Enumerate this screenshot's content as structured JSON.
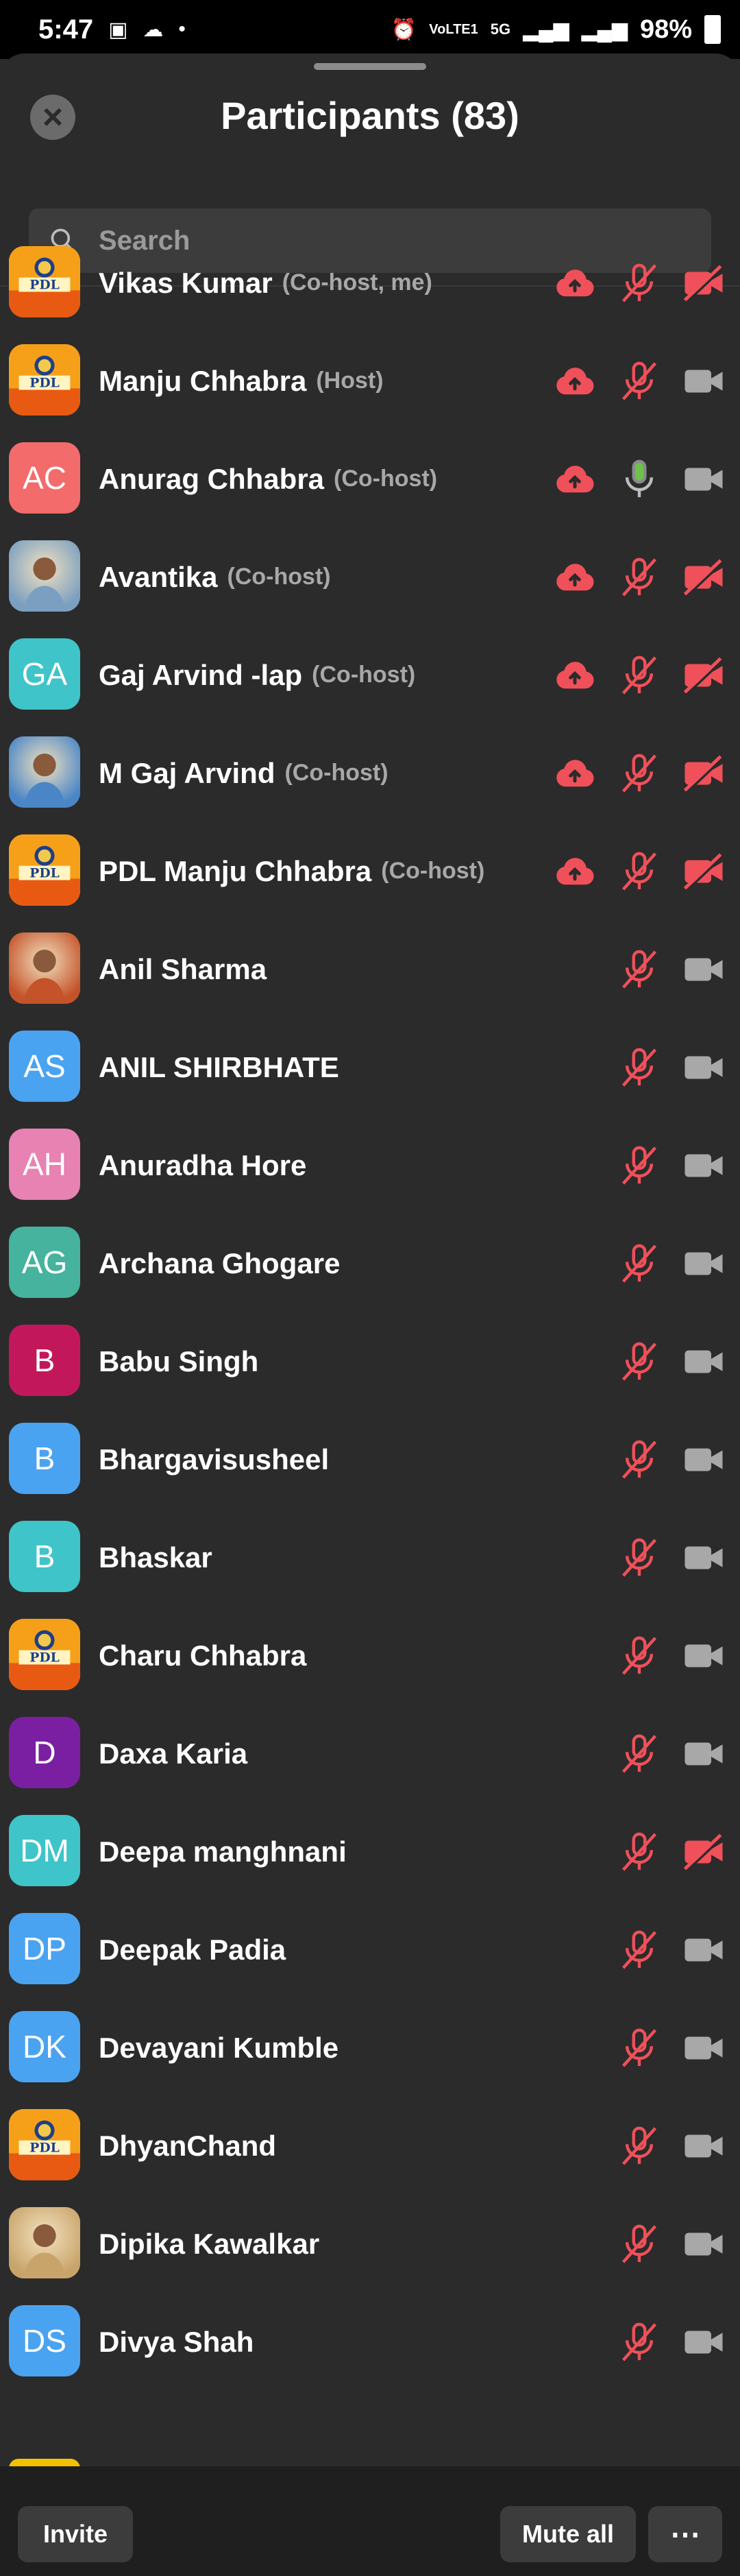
{
  "status": {
    "time": "5:47",
    "battery": "98%",
    "net1": "VoLTE1",
    "net2": "5G"
  },
  "header": {
    "title": "Participants (83)"
  },
  "search": {
    "placeholder": "Search"
  },
  "participants": [
    {
      "name": "Vikas Kumar",
      "role": "(Co-host, me)",
      "avatar_type": "logo",
      "initials": "",
      "color": "#e8a12c",
      "cloud": true,
      "mic": "muted",
      "video": "off"
    },
    {
      "name": "Manju Chhabra",
      "role": "(Host)",
      "avatar_type": "logo",
      "initials": "",
      "color": "#e8a12c",
      "cloud": true,
      "mic": "muted",
      "video": "on"
    },
    {
      "name": "Anurag Chhabra",
      "role": "(Co-host)",
      "avatar_type": "initials",
      "initials": "AC",
      "color": "#f36b6b",
      "cloud": true,
      "mic": "active",
      "video": "on"
    },
    {
      "name": "Avantika",
      "role": "(Co-host)",
      "avatar_type": "photo",
      "initials": "",
      "color": "#7a9fc0",
      "cloud": true,
      "mic": "muted",
      "video": "off"
    },
    {
      "name": "Gaj Arvind -lap",
      "role": "(Co-host)",
      "avatar_type": "initials",
      "initials": "GA",
      "color": "#3fc4c9",
      "cloud": true,
      "mic": "muted",
      "video": "off"
    },
    {
      "name": "M Gaj Arvind",
      "role": "(Co-host)",
      "avatar_type": "photo",
      "initials": "",
      "color": "#4a86c6",
      "cloud": true,
      "mic": "muted",
      "video": "off"
    },
    {
      "name": "PDL Manju Chhabra",
      "role": "(Co-host)",
      "avatar_type": "logo",
      "initials": "",
      "color": "#e8a12c",
      "cloud": true,
      "mic": "muted",
      "video": "off"
    },
    {
      "name": "Anil Sharma",
      "role": "",
      "avatar_type": "photo",
      "initials": "",
      "color": "#c4532a",
      "cloud": false,
      "mic": "muted",
      "video": "on"
    },
    {
      "name": "ANIL SHIRBHATE",
      "role": "",
      "avatar_type": "initials",
      "initials": "AS",
      "color": "#4aa3f0",
      "cloud": false,
      "mic": "muted",
      "video": "on"
    },
    {
      "name": "Anuradha Hore",
      "role": "",
      "avatar_type": "initials",
      "initials": "AH",
      "color": "#e782b2",
      "cloud": false,
      "mic": "muted",
      "video": "on"
    },
    {
      "name": "Archana Ghogare",
      "role": "",
      "avatar_type": "initials",
      "initials": "AG",
      "color": "#45b39d",
      "cloud": false,
      "mic": "muted",
      "video": "on"
    },
    {
      "name": "Babu Singh",
      "role": "",
      "avatar_type": "initials",
      "initials": "B",
      "color": "#c2185b",
      "cloud": false,
      "mic": "muted",
      "video": "on"
    },
    {
      "name": "Bhargavisusheel",
      "role": "",
      "avatar_type": "initials",
      "initials": "B",
      "color": "#4aa3f0",
      "cloud": false,
      "mic": "muted",
      "video": "on"
    },
    {
      "name": "Bhaskar",
      "role": "",
      "avatar_type": "initials",
      "initials": "B",
      "color": "#3fc4c9",
      "cloud": false,
      "mic": "muted",
      "video": "on"
    },
    {
      "name": "Charu Chhabra",
      "role": "",
      "avatar_type": "logo",
      "initials": "",
      "color": "#e8a12c",
      "cloud": false,
      "mic": "muted",
      "video": "on"
    },
    {
      "name": "Daxa Karia",
      "role": "",
      "avatar_type": "initials",
      "initials": "D",
      "color": "#7b1fa2",
      "cloud": false,
      "mic": "muted",
      "video": "on"
    },
    {
      "name": "Deepa manghnani",
      "role": "",
      "avatar_type": "initials",
      "initials": "DM",
      "color": "#3fc4c9",
      "cloud": false,
      "mic": "muted",
      "video": "off"
    },
    {
      "name": "Deepak Padia",
      "role": "",
      "avatar_type": "initials",
      "initials": "DP",
      "color": "#4aa3f0",
      "cloud": false,
      "mic": "muted",
      "video": "on"
    },
    {
      "name": "Devayani Kumble",
      "role": "",
      "avatar_type": "initials",
      "initials": "DK",
      "color": "#4aa3f0",
      "cloud": false,
      "mic": "muted",
      "video": "on"
    },
    {
      "name": "DhyanChand",
      "role": "",
      "avatar_type": "logo",
      "initials": "",
      "color": "#e8a12c",
      "cloud": false,
      "mic": "muted",
      "video": "on"
    },
    {
      "name": "Dipika Kawalkar",
      "role": "",
      "avatar_type": "photo",
      "initials": "",
      "color": "#c9a46a",
      "cloud": false,
      "mic": "muted",
      "video": "on"
    },
    {
      "name": "Divya Shah",
      "role": "",
      "avatar_type": "initials",
      "initials": "DS",
      "color": "#4aa3f0",
      "cloud": false,
      "mic": "muted",
      "video": "on"
    }
  ],
  "footer": {
    "invite_label": "Invite",
    "mute_all_label": "Mute all",
    "more_label": "⋯"
  },
  "colors": {
    "muted_red": "#f0505a",
    "active_green": "#6cc24a",
    "video_gray": "#a8a8a8"
  }
}
